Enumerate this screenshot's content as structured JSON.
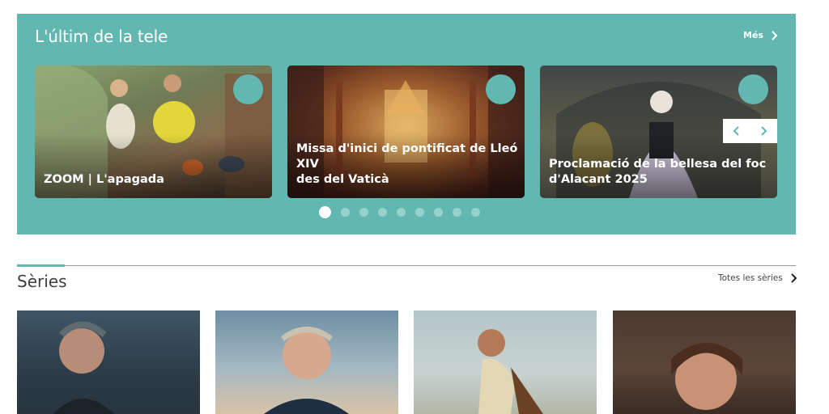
{
  "latest": {
    "title": "L'últim de la tele",
    "more_label": "Més",
    "cards": [
      {
        "title": "ZOOM | L'apagada"
      },
      {
        "title": "Missa d'inici de pontificat de Lleó XIV\ndes del Vaticà"
      },
      {
        "title": "Proclamació de la bellesa del foc\nd'Alacant 2025"
      }
    ],
    "dots_count": 9,
    "active_dot": 0
  },
  "series": {
    "title": "Sèries",
    "all_label": "Totes les sèries"
  },
  "colors": {
    "accent": "#62b8b0",
    "white": "#ffffff",
    "text_dark": "#3d3d3d"
  },
  "icons": {
    "more": "chevron-right-icon",
    "prev": "chevron-left-icon",
    "next": "chevron-right-icon",
    "all_series": "chevron-right-icon"
  }
}
